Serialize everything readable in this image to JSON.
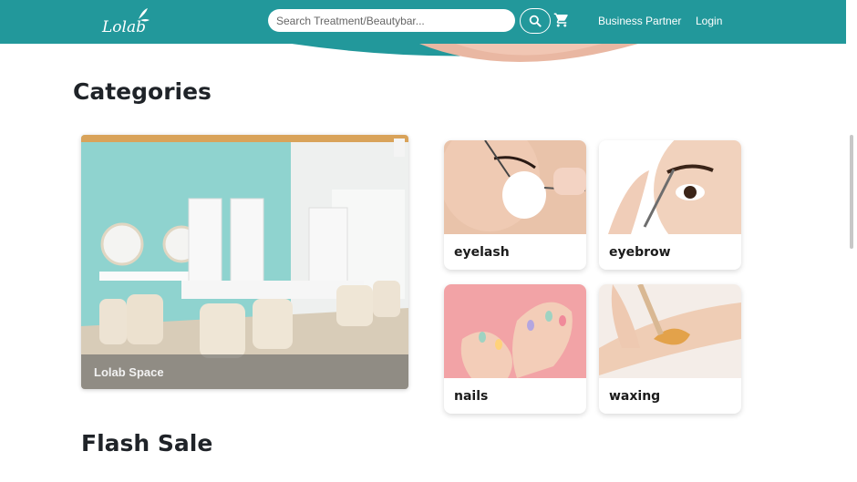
{
  "header": {
    "logo_text": "Lolab",
    "search_placeholder": "Search Treatment/Beautybar...",
    "nav": [
      {
        "label": "Business Partner"
      },
      {
        "label": "Login"
      }
    ]
  },
  "sections": {
    "categories_title": "Categories",
    "flash_sale_title": "Flash Sale"
  },
  "featured": {
    "label": "Lolab Space"
  },
  "categories": [
    {
      "label": "eyelash"
    },
    {
      "label": "eyebrow"
    },
    {
      "label": "nails"
    },
    {
      "label": "waxing"
    }
  ],
  "colors": {
    "brand": "#22989b",
    "background": "#ffffff",
    "text": "#1f2328"
  }
}
